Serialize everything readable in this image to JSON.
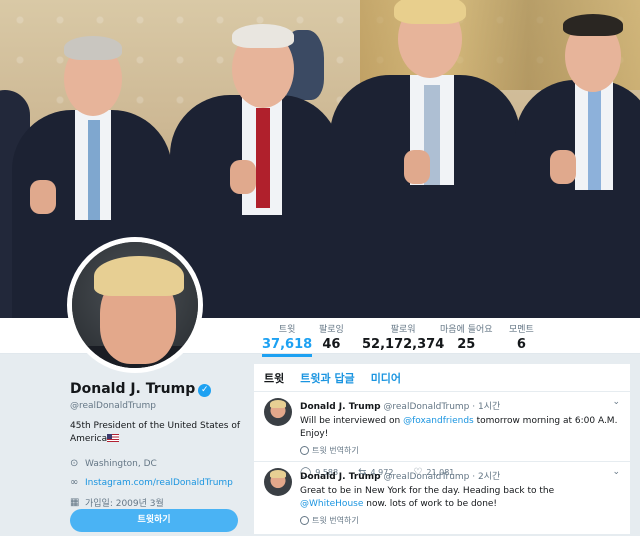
{
  "header": {
    "image_description_icon": "header-photo"
  },
  "stats": [
    {
      "label": "트윗",
      "value": "37,618",
      "active": true
    },
    {
      "label": "팔로잉",
      "value": "46",
      "active": false
    },
    {
      "label": "팔로워",
      "value": "52,172,374",
      "active": false
    },
    {
      "label": "마음에 들어요",
      "value": "25",
      "active": false
    },
    {
      "label": "모멘트",
      "value": "6",
      "active": false
    }
  ],
  "profile": {
    "name": "Donald J. Trump",
    "handle": "@realDonaldTrump",
    "bio": "45th President of the United States of America",
    "location": "Washington, DC",
    "website": "Instagram.com/realDonaldTrump",
    "joined": "가입일: 2009년 3월",
    "tweet_button": "트윗하기",
    "accent": "#1da1f2"
  },
  "timeline": {
    "tabs": [
      "트윗",
      "트윗과 답글",
      "미디어"
    ],
    "tweets": [
      {
        "name": "Donald J. Trump",
        "handle": "@realDonaldTrump",
        "time": "· 1시간",
        "text_before": "Will be interviewed on ",
        "link": "@foxandfriends",
        "text_after": " tomorrow morning at 6:00 A.M. Enjoy!",
        "translate": "트윗 번역하기",
        "replies": "9,588",
        "retweets": "4,972",
        "likes": "21,081"
      },
      {
        "name": "Donald J. Trump",
        "handle": "@realDonaldTrump",
        "time": "· 2시간",
        "text_before": "Great to be in New York for the day. Heading back to the ",
        "link": "@WhiteHouse",
        "text_after": " now. lots of work to be done!",
        "translate": "트윗 번역하기"
      }
    ]
  }
}
